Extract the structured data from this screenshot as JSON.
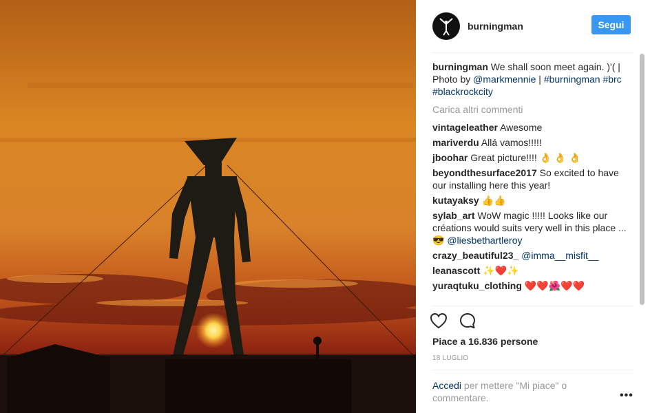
{
  "post": {
    "username": "burningman",
    "follow_label": "Segui",
    "caption_user": "burningman",
    "caption_text": "We shall soon meet again. )'( | Photo by",
    "caption_mention": "@markmennie",
    "caption_sep": "|",
    "caption_tags": "#burningman #brc #blackrockcity",
    "load_more": "Carica altri commenti",
    "likes": "Piace a 16.836 persone",
    "date": "18 LUGLIO",
    "login_link": "Accedi",
    "login_rest": "per mettere \"Mi piace\" o commentare.",
    "more_label": "•••"
  },
  "comments": [
    {
      "user": "vintageleather",
      "text": "Awesome",
      "mention": ""
    },
    {
      "user": "mariverdu",
      "text": "Allá vamos!!!!!",
      "mention": ""
    },
    {
      "user": "jboohar",
      "text": "Great picture!!!! 👌 👌 👌",
      "mention": ""
    },
    {
      "user": "beyondthesurface2017",
      "text": "So excited to have our installing here this year!",
      "mention": ""
    },
    {
      "user": "kutayaksy",
      "text": "👍👍",
      "mention": ""
    },
    {
      "user": "sylab_art",
      "text": "WoW magic !!!!! Looks like our créations would suits very well in this place ... 😎",
      "mention": "@liesbethartleroy"
    },
    {
      "user": "crazy_beautiful23_",
      "text": "",
      "mention": "@imma__misfit__"
    },
    {
      "user": "leanascott",
      "text": "✨❤️✨",
      "mention": ""
    },
    {
      "user": "yuraqtuku_clothing",
      "text": "❤️❤️🌺❤️❤️",
      "mention": ""
    }
  ],
  "icons": {
    "like": "heart-icon",
    "comment": "comment-icon",
    "avatar": "burning-man-logo-icon"
  },
  "colors": {
    "follow": "#3897f0",
    "link": "#003569",
    "muted": "#999999"
  }
}
